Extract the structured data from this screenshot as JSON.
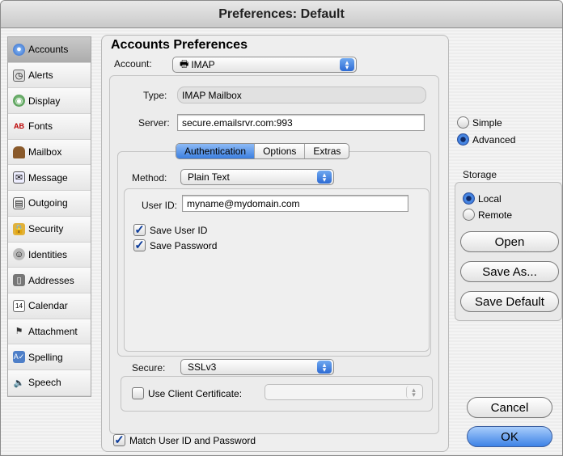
{
  "window": {
    "title": "Preferences: Default"
  },
  "sidebar": {
    "items": [
      {
        "label": "Accounts",
        "icon": "globe-icon"
      },
      {
        "label": "Alerts",
        "icon": "clock-icon"
      },
      {
        "label": "Display",
        "icon": "display-icon"
      },
      {
        "label": "Fonts",
        "icon": "fonts-icon"
      },
      {
        "label": "Mailbox",
        "icon": "mailbox-icon"
      },
      {
        "label": "Message",
        "icon": "envelope-icon"
      },
      {
        "label": "Outgoing",
        "icon": "outgoing-icon"
      },
      {
        "label": "Security",
        "icon": "lock-icon"
      },
      {
        "label": "Identities",
        "icon": "identities-icon"
      },
      {
        "label": "Addresses",
        "icon": "address-book-icon"
      },
      {
        "label": "Calendar",
        "icon": "calendar-icon"
      },
      {
        "label": "Attachment",
        "icon": "paperclip-icon"
      },
      {
        "label": "Spelling",
        "icon": "spelling-icon"
      },
      {
        "label": "Speech",
        "icon": "speech-icon"
      }
    ]
  },
  "main": {
    "heading": "Accounts Preferences",
    "account_label": "Account:",
    "account_value": "IMAP",
    "type_label": "Type:",
    "type_value": "IMAP Mailbox",
    "server_label": "Server:",
    "server_value": "secure.emailsrvr.com:993",
    "tabs": [
      {
        "label": "Authentication"
      },
      {
        "label": "Options"
      },
      {
        "label": "Extras"
      }
    ],
    "method_label": "Method:",
    "method_value": "Plain Text",
    "userid_label": "User ID:",
    "userid_value": "myname@mydomain.com",
    "save_userid_label": "Save User ID",
    "save_password_label": "Save Password",
    "secure_label": "Secure:",
    "secure_value": "SSLv3",
    "client_cert_label": "Use Client Certificate:",
    "match_label": "Match User ID and Password"
  },
  "right": {
    "mode_simple": "Simple",
    "mode_advanced": "Advanced",
    "storage_title": "Storage",
    "storage_local": "Local",
    "storage_remote": "Remote",
    "open_label": "Open",
    "save_as_label": "Save As...",
    "save_default_label": "Save Default",
    "cancel_label": "Cancel",
    "ok_label": "OK"
  }
}
